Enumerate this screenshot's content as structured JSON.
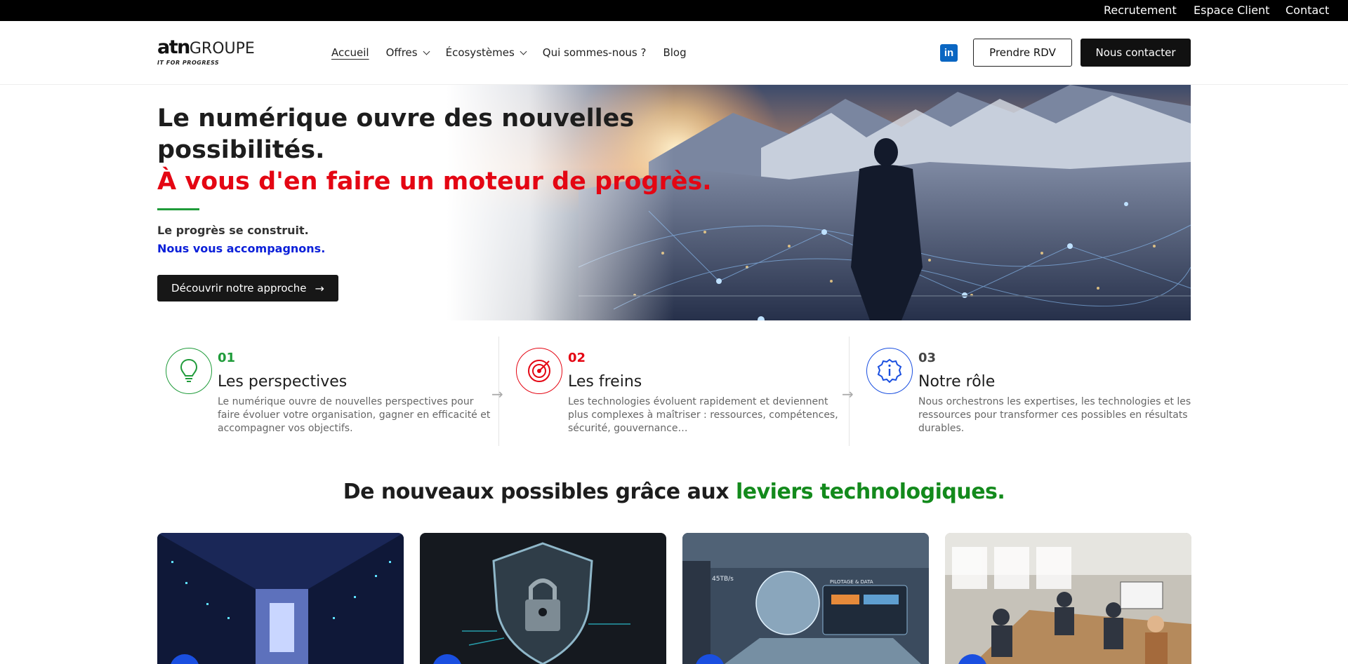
{
  "topbar": {
    "links": [
      "Recrutement",
      "Espace Client",
      "Contact"
    ]
  },
  "header": {
    "logo": {
      "brand_bold": "atn",
      "brand_light": "GROUPE",
      "tagline": "IT FOR PROGRESS"
    },
    "nav": [
      {
        "label": "Accueil",
        "active": true,
        "dropdown": false
      },
      {
        "label": "Offres",
        "active": false,
        "dropdown": true
      },
      {
        "label": "Écosystèmes",
        "active": false,
        "dropdown": true
      },
      {
        "label": "Qui sommes-nous ?",
        "active": false,
        "dropdown": false
      },
      {
        "label": "Blog",
        "active": false,
        "dropdown": false
      }
    ],
    "linkedin_icon": "linkedin-icon",
    "rdv_label": "Prendre RDV",
    "contact_label": "Nous contacter"
  },
  "hero": {
    "title": "Le numérique ouvre des nouvelles possibilités.",
    "title_red": "À vous d'en faire un moteur de progrès.",
    "subtitle_1": "Le progrès se construit.",
    "subtitle_2": "Nous vous accompagnons.",
    "cta_label": "Découvrir notre approche",
    "image_icon": "city-landscape-image"
  },
  "steps": [
    {
      "num": "01",
      "title": "Les perspectives",
      "desc": "Le numérique ouvre de nouvelles perspectives pour faire évoluer votre organisation, gagner en efficacité et accompagner vos objectifs.",
      "color": "#1f9b3a",
      "icon": "lightbulb-icon"
    },
    {
      "num": "02",
      "title": "Les freins",
      "desc": "Les technologies évoluent rapidement et deviennent plus complexes à maîtriser : ressources, compétences, sécurité, gouvernance…",
      "color": "#e40613",
      "icon": "target-icon"
    },
    {
      "num": "03",
      "title": "Notre rôle",
      "desc": "Nous orchestrons les expertises, les technologies et les ressources pour transformer ces possibles en résultats durables.",
      "color": "#444444",
      "icon": "info-badge-icon"
    }
  ],
  "section": {
    "title_main": "De nouveaux possibles grâce aux ",
    "title_green": "leviers technologiques."
  },
  "cards": [
    {
      "image": "datacenter-image"
    },
    {
      "image": "security-shield-image"
    },
    {
      "image": "data-hologram-image"
    },
    {
      "image": "office-team-image"
    }
  ],
  "colors": {
    "accent_red": "#e40613",
    "accent_green": "#138a1c",
    "accent_blue": "#0a1fd9",
    "linkedin": "#0a66c2"
  }
}
